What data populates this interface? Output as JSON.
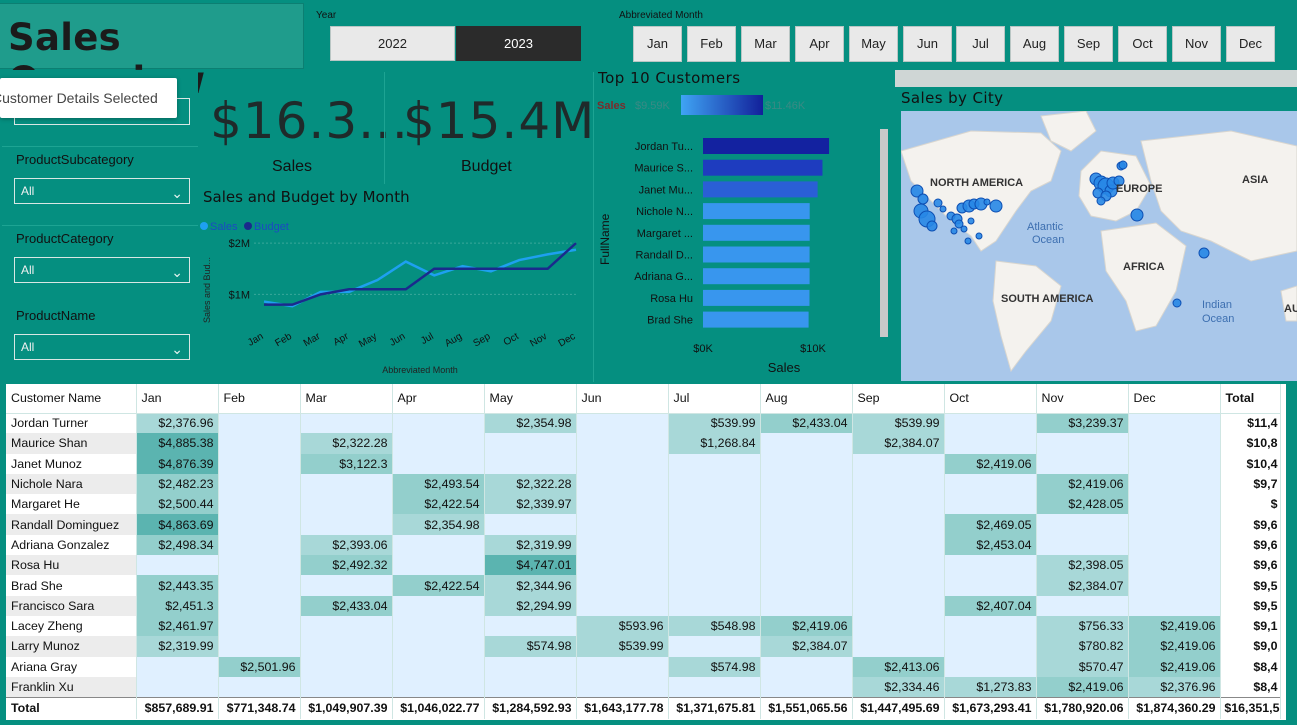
{
  "title": "Sales Overview",
  "year_slicer": {
    "label": "Year",
    "options": [
      "2022",
      "2023"
    ],
    "selected": "2023"
  },
  "month_slicer": {
    "label": "Abbreviated Month",
    "options": [
      "Jan",
      "Feb",
      "Mar",
      "Apr",
      "May",
      "Jun",
      "Jul",
      "Aug",
      "Sep",
      "Oct",
      "Nov",
      "Dec"
    ]
  },
  "tooltip": "Customer Details Selected",
  "filters": [
    {
      "label": "ProductSubcategory",
      "value": "All"
    },
    {
      "label": "ProductCategory",
      "value": "All"
    },
    {
      "label": "ProductName",
      "value": "All"
    }
  ],
  "kpis": [
    {
      "value": "$16.3...",
      "label": "Sales"
    },
    {
      "value": "$15.4M",
      "label": "Budget"
    }
  ],
  "line_chart": {
    "title": "Sales and Budget by Month",
    "legend": [
      "Sales",
      "Budget"
    ],
    "ylabel": "Sales and Bud...",
    "xlabel": "Abbreviated Month",
    "yticks": [
      "$2M",
      "$1M"
    ]
  },
  "bar_chart": {
    "title": "Top 10 Customers",
    "color_legend": {
      "label": "Sales",
      "min": "$9.59K",
      "max": "$11.46K"
    },
    "ylabel": "FullName",
    "xlabel": "Sales",
    "xticks": [
      "$0K",
      "$10K"
    ]
  },
  "map": {
    "title": "Sales by City",
    "labels": [
      "NORTH AMERICA",
      "EUROPE",
      "ASIA",
      "Atlantic",
      "Ocean",
      "AFRICA",
      "SOUTH AMERICA",
      "Indian",
      "Ocean",
      "AU"
    ]
  },
  "matrix": {
    "headers": [
      "Customer Name",
      "Jan",
      "Feb",
      "Mar",
      "Apr",
      "May",
      "Jun",
      "Jul",
      "Aug",
      "Sep",
      "Oct",
      "Nov",
      "Dec",
      "Total"
    ],
    "rows": [
      {
        "name": "Jordan Turner",
        "cells": [
          "$2,376.96",
          "",
          "",
          "",
          "$2,354.98",
          "",
          "$539.99",
          "$2,433.04",
          "$539.99",
          "",
          "$3,239.37",
          ""
        ],
        "total": "$11,4"
      },
      {
        "name": "Maurice Shan",
        "cells": [
          "$4,885.38",
          "",
          "$2,322.28",
          "",
          "",
          "",
          "$1,268.84",
          "",
          "$2,384.07",
          "",
          "",
          ""
        ],
        "total": "$10,8"
      },
      {
        "name": "Janet Munoz",
        "cells": [
          "$4,876.39",
          "",
          "$3,122.3",
          "",
          "",
          "",
          "",
          "",
          "",
          "$2,419.06",
          "",
          ""
        ],
        "total": "$10,4"
      },
      {
        "name": "Nichole Nara",
        "cells": [
          "$2,482.23",
          "",
          "",
          "$2,493.54",
          "$2,322.28",
          "",
          "",
          "",
          "",
          "",
          "$2,419.06",
          ""
        ],
        "total": "$9,7"
      },
      {
        "name": "Margaret He",
        "cells": [
          "$2,500.44",
          "",
          "",
          "$2,422.54",
          "$2,339.97",
          "",
          "",
          "",
          "",
          "",
          "$2,428.05",
          ""
        ],
        "total": "$"
      },
      {
        "name": "Randall Dominguez",
        "cells": [
          "$4,863.69",
          "",
          "",
          "$2,354.98",
          "",
          "",
          "",
          "",
          "",
          "$2,469.05",
          "",
          ""
        ],
        "total": "$9,6"
      },
      {
        "name": "Adriana Gonzalez",
        "cells": [
          "$2,498.34",
          "",
          "$2,393.06",
          "",
          "$2,319.99",
          "",
          "",
          "",
          "",
          "$2,453.04",
          "",
          ""
        ],
        "total": "$9,6"
      },
      {
        "name": "Rosa Hu",
        "cells": [
          "",
          "",
          "$2,492.32",
          "",
          "$4,747.01",
          "",
          "",
          "",
          "",
          "",
          "$2,398.05",
          ""
        ],
        "total": "$9,6"
      },
      {
        "name": "Brad She",
        "cells": [
          "$2,443.35",
          "",
          "",
          "$2,422.54",
          "$2,344.96",
          "",
          "",
          "",
          "",
          "",
          "$2,384.07",
          ""
        ],
        "total": "$9,5"
      },
      {
        "name": "Francisco Sara",
        "cells": [
          "$2,451.3",
          "",
          "$2,433.04",
          "",
          "$2,294.99",
          "",
          "",
          "",
          "",
          "$2,407.04",
          "",
          ""
        ],
        "total": "$9,5"
      },
      {
        "name": "Lacey Zheng",
        "cells": [
          "$2,461.97",
          "",
          "",
          "",
          "",
          "$593.96",
          "$548.98",
          "$2,419.06",
          "",
          "",
          "$756.33",
          "$2,419.06"
        ],
        "total": "$9,1"
      },
      {
        "name": "Larry Munoz",
        "cells": [
          "$2,319.99",
          "",
          "",
          "",
          "$574.98",
          "$539.99",
          "",
          "$2,384.07",
          "",
          "",
          "$780.82",
          "$2,419.06"
        ],
        "total": "$9,0"
      },
      {
        "name": "Ariana Gray",
        "cells": [
          "",
          "$2,501.96",
          "",
          "",
          "",
          "",
          "$574.98",
          "",
          "$2,413.06",
          "",
          "$570.47",
          "$2,419.06"
        ],
        "total": "$8,4"
      },
      {
        "name": "Franklin Xu",
        "cells": [
          "",
          "",
          "",
          "",
          "",
          "",
          "",
          "",
          "$2,334.46",
          "$1,273.83",
          "$2,419.06",
          "$2,376.96"
        ],
        "total": "$8,4"
      }
    ],
    "total_row": {
      "name": "Total",
      "cells": [
        "$857,689.91",
        "$771,348.74",
        "$1,049,907.39",
        "$1,046,022.77",
        "$1,284,592.93",
        "$1,643,177.78",
        "$1,371,675.81",
        "$1,551,065.56",
        "$1,447,495.69",
        "$1,673,293.41",
        "$1,780,920.06",
        "$1,874,360.29"
      ],
      "total": "$16,351,5"
    }
  },
  "chart_data": [
    {
      "type": "line",
      "title": "Sales and Budget by Month",
      "xlabel": "Abbreviated Month",
      "ylabel": "Sales and Bud...",
      "categories": [
        "Jan",
        "Feb",
        "Mar",
        "Apr",
        "May",
        "Jun",
        "Jul",
        "Aug",
        "Sep",
        "Oct",
        "Nov",
        "Dec"
      ],
      "ylim": [
        0.5,
        2.1
      ],
      "series": [
        {
          "name": "Sales",
          "color": "#1ea0f0",
          "values": [
            0.86,
            0.77,
            1.05,
            1.05,
            1.28,
            1.64,
            1.37,
            1.55,
            1.45,
            1.67,
            1.78,
            1.87
          ]
        },
        {
          "name": "Budget",
          "color": "#1a2a8c",
          "values": [
            0.8,
            0.8,
            1.0,
            1.1,
            1.1,
            1.1,
            1.5,
            1.5,
            1.5,
            1.5,
            1.5,
            2.0
          ]
        }
      ]
    },
    {
      "type": "bar",
      "title": "Top 10 Customers",
      "xlabel": "Sales",
      "ylabel": "FullName",
      "categories": [
        "Jordan Tu...",
        "Maurice S...",
        "Janet Mu...",
        "Nichole N...",
        "Margaret ...",
        "Randall D...",
        "Adriana G...",
        "Rosa Hu",
        "Brad She"
      ],
      "values": [
        11460,
        10860,
        10420,
        9700,
        9700,
        9690,
        9690,
        9680,
        9600
      ],
      "xlim": [
        0,
        12000
      ],
      "colors": [
        "#1322a0",
        "#1e3cbf",
        "#2a5fd6",
        "#3896ee",
        "#3896ee",
        "#3896ee",
        "#3896ee",
        "#3896ee",
        "#3896ee"
      ]
    }
  ]
}
